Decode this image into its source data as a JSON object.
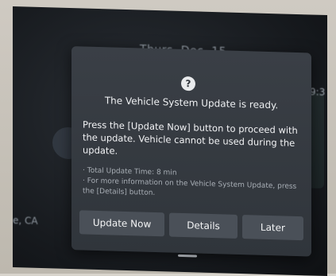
{
  "background": {
    "date": "Thurs, Dec. 15",
    "time": "9:3",
    "location": "e, CA"
  },
  "dialog": {
    "icon": "question-icon",
    "icon_glyph": "?",
    "title": "The Vehicle System Update is ready.",
    "message": "Press the [Update Now] button to proceed with the update. Vehicle cannot be used during the update.",
    "notes": [
      "· Total Update Time: 8 min",
      "· For more information on the Vehicle System Update, press the [Details] button."
    ],
    "buttons": {
      "update_now": "Update Now",
      "details": "Details",
      "later": "Later"
    }
  }
}
